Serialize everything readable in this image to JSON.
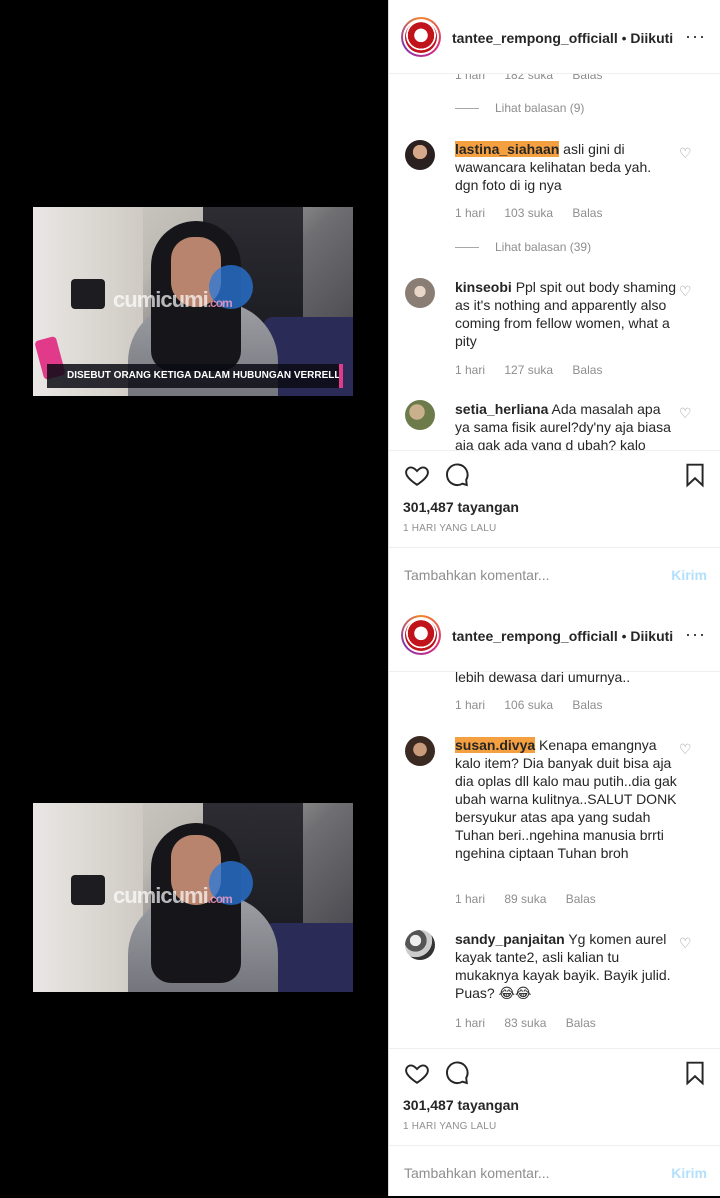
{
  "posts": [
    {
      "header": {
        "username": "tantee_rempong_officiall",
        "separator": "•",
        "follow_status": "Diikuti",
        "more": "···"
      },
      "video": {
        "watermark": "cumicumi",
        "watermark_suffix": ".com",
        "caption": "DISEBUT ORANG KETIGA DALAM HUBUNGAN VERRELL-WILONA, INI REAKSI AUREL"
      },
      "top_meta": {
        "time": "1 hari",
        "likes": "182 suka",
        "reply": "Balas"
      },
      "replies_1": "Lihat balasan (9)",
      "comments": [
        {
          "user": "lastina_siahaan",
          "text": "asli gini di wawancara kelihatan beda yah. dgn foto di ig nya",
          "time": "1 hari",
          "likes": "103 suka",
          "reply": "Balas",
          "view_replies": "Lihat balasan (39)"
        },
        {
          "user": "kinseobi",
          "text": "Ppl spit out body shaming as it's nothing and apparently also coming from fellow women, what a pity",
          "time": "1 hari",
          "likes": "127 suka",
          "reply": "Balas"
        },
        {
          "user": "setia_herliana",
          "text": "Ada masalah apa ya sama fisik aurel?dy'ny aja biasa aja gak ada yang d ubah? kalo"
        }
      ],
      "views": "301,487 tayangan",
      "posted": "1 HARI YANG LALU",
      "add_comment_placeholder": "Tambahkan komentar...",
      "send_label": "Kirim"
    },
    {
      "header": {
        "username": "tantee_rempong_officiall",
        "separator": "•",
        "follow_status": "Diikuti",
        "more": "···"
      },
      "video": {
        "watermark": "cumicumi",
        "watermark_suffix": ".com"
      },
      "top_text": "lebih dewasa dari umurnya..",
      "top_meta": {
        "time": "1 hari",
        "likes": "106 suka",
        "reply": "Balas"
      },
      "comments": [
        {
          "user": "susan.divya",
          "text": "Kenapa emangnya kalo item? Dia banyak duit bisa aja dia oplas dll kalo mau putih..dia gak ubah warna kulitnya..SALUT DONK bersyukur atas apa yang sudah Tuhan beri..ngehina manusia brrti ngehina ciptaan Tuhan broh",
          "time": "1 hari",
          "likes": "89 suka",
          "reply": "Balas"
        },
        {
          "user": "sandy_panjaitan",
          "text": "Yg komen aurel kayak tante2, asli kalian tu mukaknya kayak bayik. Bayik julid. Puas? 😂😂",
          "time": "1 hari",
          "likes": "83 suka",
          "reply": "Balas"
        }
      ],
      "views": "301,487 tayangan",
      "posted": "1 HARI YANG LALU",
      "add_comment_placeholder": "Tambahkan komentar...",
      "send_label": "Kirim"
    }
  ],
  "icons": [
    "heart-icon",
    "comment-icon",
    "bookmark-icon",
    "more-icon"
  ]
}
